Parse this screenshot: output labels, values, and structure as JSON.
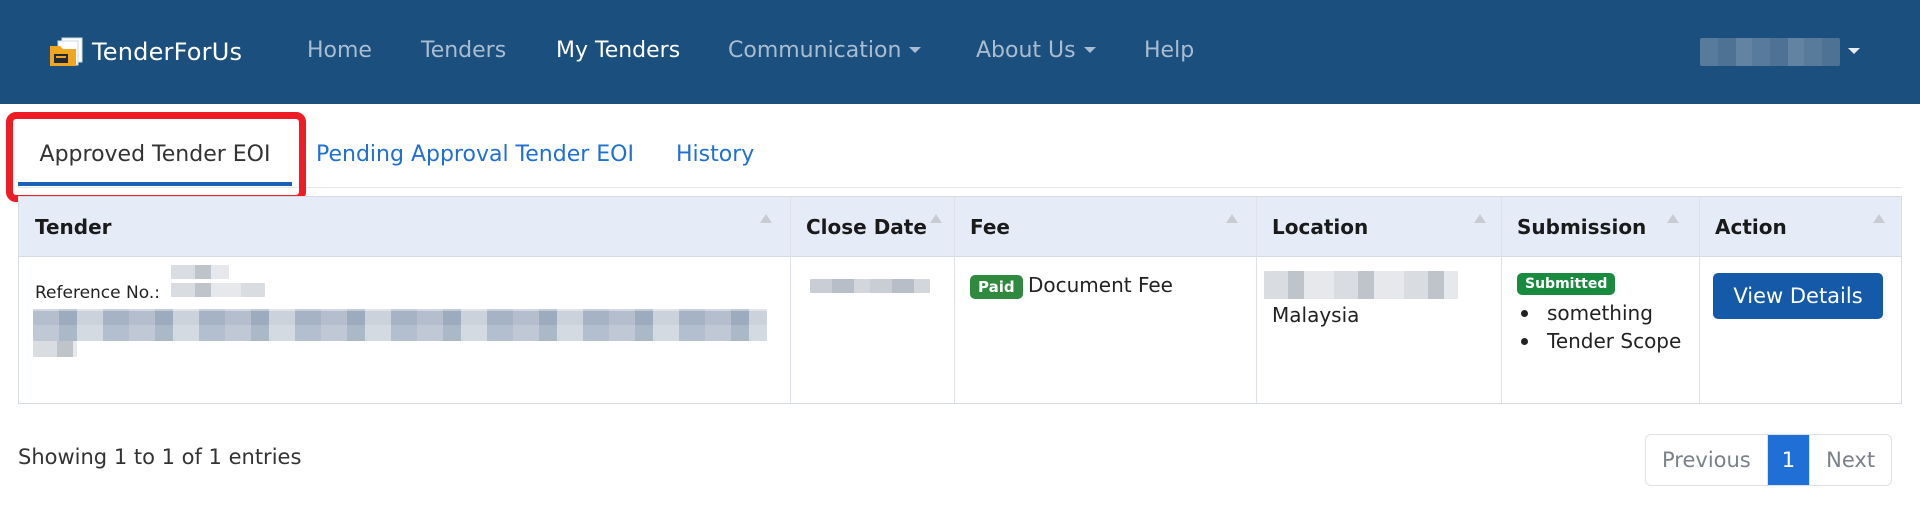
{
  "brand": {
    "name": "TenderForUs"
  },
  "nav": {
    "items": [
      {
        "label": "Home"
      },
      {
        "label": "Tenders"
      },
      {
        "label": "My Tenders"
      },
      {
        "label": "Communication"
      },
      {
        "label": "About Us"
      },
      {
        "label": "Help"
      }
    ],
    "active": "My Tenders"
  },
  "tabs": [
    {
      "label": "Approved Tender EOI",
      "active": true
    },
    {
      "label": "Pending Approval Tender EOI",
      "active": false
    },
    {
      "label": "History",
      "active": false
    }
  ],
  "table": {
    "columns": [
      {
        "label": "Tender"
      },
      {
        "label": "Close Date"
      },
      {
        "label": "Fee"
      },
      {
        "label": "Location"
      },
      {
        "label": "Submission"
      },
      {
        "label": "Action"
      }
    ],
    "rows": [
      {
        "reference_label": "Reference No.:",
        "fee_badge": "Paid",
        "fee_text": "Document Fee",
        "location_country": "Malaysia",
        "submission_badge": "Submitted",
        "submission_items": [
          "something",
          "Tender Scope"
        ],
        "action_label": "View Details"
      }
    ]
  },
  "footer": {
    "showing": "Showing 1 to 1 of 1 entries",
    "pagination": {
      "previous": "Previous",
      "current": "1",
      "next": "Next"
    }
  },
  "colors": {
    "navbar": "#1b4f7e",
    "accent": "#1f6fd6",
    "primary_button": "#155aa8",
    "success": "#198b3f",
    "highlight": "#ee1c24"
  },
  "icons": {
    "logo": "folder-stack-icon",
    "dropdown": "caret-down-icon",
    "sort": "sort-arrow-icon"
  }
}
